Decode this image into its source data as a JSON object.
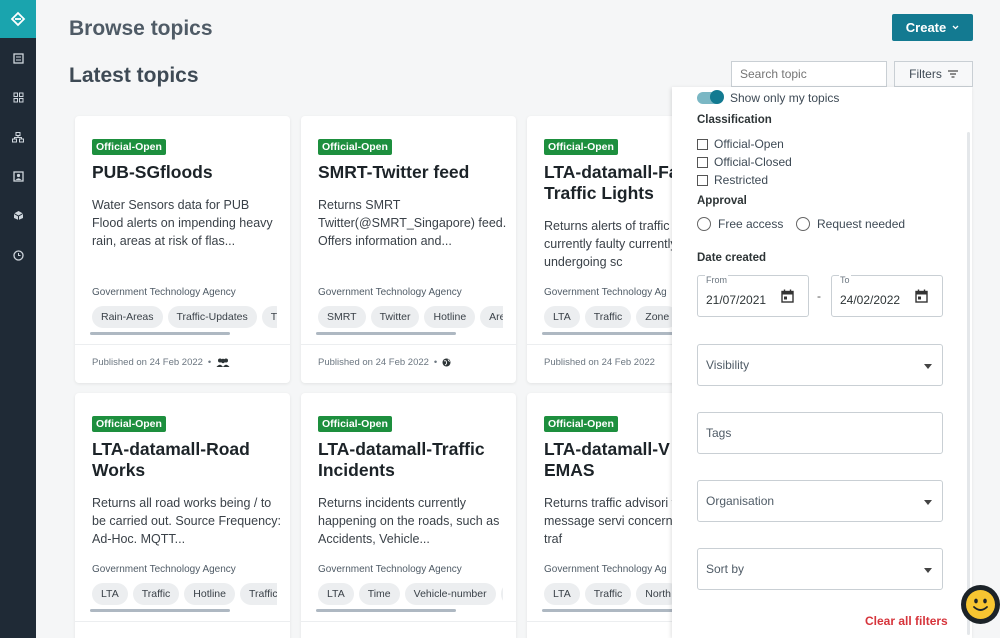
{
  "header": {
    "title": "Browse topics",
    "section_title": "Latest topics",
    "create_label": "Create",
    "search_placeholder": "Search topic",
    "filters_label": "Filters"
  },
  "sidebar": {
    "items": [
      "logo-icon",
      "catalog-icon",
      "grid-icon",
      "hierarchy-icon",
      "contact-icon",
      "box-icon",
      "history-icon"
    ]
  },
  "cards": [
    {
      "badge": "Official-Open",
      "title": "PUB-SGfloods",
      "description": "Water Sensors data for PUB Flood alerts on impending heavy rain, areas at risk of flas...",
      "org": "Government Technology Agency",
      "tags": [
        "Rain-Areas",
        "Traffic-Updates",
        "T"
      ],
      "published": "Published on 24 Feb 2022",
      "visibility_icon": "group-icon"
    },
    {
      "badge": "Official-Open",
      "title": "SMRT-Twitter feed",
      "description": "Returns SMRT Twitter(@SMRT_Singapore) feed. Offers information and...",
      "org": "Government Technology Agency",
      "tags": [
        "SMRT",
        "Twitter",
        "Hotline",
        "Are"
      ],
      "published": "Published on 24 Feb 2022",
      "visibility_icon": "globe-icon"
    },
    {
      "badge": "Official-Open",
      "title": "LTA-datamall-Fa\nTraffic Lights",
      "description": "Returns alerts of traffic that are currently faulty currently undergoing sc",
      "org": "Government Technology Ag",
      "tags": [
        "LTA",
        "Traffic",
        "Zone"
      ],
      "published": "Published on 24 Feb 2022"
    },
    {
      "badge": "Official-Open",
      "title": "LTA-datamall-Road\nWorks",
      "description": "Returns all road works being / to be carried out. Source Frequency: Ad-Hoc. MQTT...",
      "org": "Government Technology Agency",
      "tags": [
        "LTA",
        "Traffic",
        "Hotline",
        "Traffic"
      ]
    },
    {
      "badge": "Official-Open",
      "title": "LTA-datamall-Traffic\nIncidents",
      "description": "Returns incidents currently happening on the roads, such as Accidents, Vehicle...",
      "org": "Government Technology Agency",
      "tags": [
        "LTA",
        "Time",
        "Vehicle-number",
        "I"
      ]
    },
    {
      "badge": "Official-Open",
      "title": "LTA-datamall-V\nEMAS",
      "description": "Returns traffic advisori variable message servi concerning current traf",
      "org": "Government Technology Ag",
      "tags": [
        "LTA",
        "Traffic",
        "North"
      ]
    }
  ],
  "filters": {
    "toggle_label": "Show only my topics",
    "toggle_on": true,
    "classification_heading": "Classification",
    "classification_options": [
      "Official-Open",
      "Official-Closed",
      "Restricted"
    ],
    "approval_heading": "Approval",
    "approval_options": [
      "Free access",
      "Request needed"
    ],
    "date_heading": "Date created",
    "from_label": "From",
    "from_value": "21/07/2021",
    "to_label": "To",
    "to_value": "24/02/2022",
    "date_separator": "-",
    "visibility_label": "Visibility",
    "tags_label": "Tags",
    "organisation_label": "Organisation",
    "sort_label": "Sort by",
    "clear_label": "Clear all filters"
  },
  "colors": {
    "accent": "#137a91",
    "badge": "#1d8f3e",
    "sidebar": "#1f2a36",
    "logo_bg": "#1aa4ae",
    "danger": "#d6343b"
  }
}
